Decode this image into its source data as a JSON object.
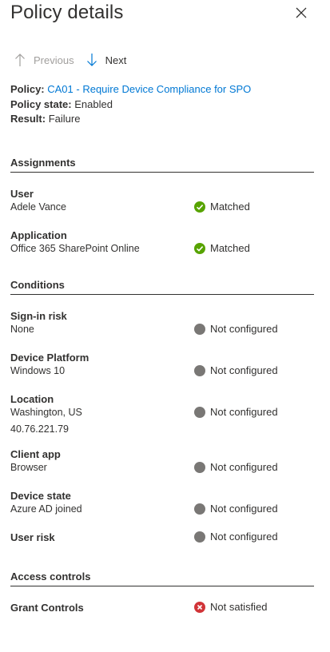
{
  "panel": {
    "title": "Policy details",
    "close_icon": "close-icon"
  },
  "nav": {
    "previous_label": "Previous",
    "next_label": "Next"
  },
  "summary": {
    "policy_label": "Policy:",
    "policy_value": "CA01 - Require Device Compliance for SPO",
    "state_label": "Policy state:",
    "state_value": "Enabled",
    "result_label": "Result:",
    "result_value": "Failure"
  },
  "sections": {
    "assignments": "Assignments",
    "conditions": "Conditions",
    "access_controls": "Access controls"
  },
  "assignments": {
    "user": {
      "label": "User",
      "value": "Adele Vance",
      "status": "Matched"
    },
    "application": {
      "label": "Application",
      "value": "Office 365 SharePoint Online",
      "status": "Matched"
    }
  },
  "conditions": {
    "signin_risk": {
      "label": "Sign-in risk",
      "value": "None",
      "status": "Not configured"
    },
    "device_platform": {
      "label": "Device Platform",
      "value": "Windows 10",
      "status": "Not configured"
    },
    "location": {
      "label": "Location",
      "value": "Washington, US",
      "value2": "40.76.221.79",
      "status": "Not configured"
    },
    "client_app": {
      "label": "Client app",
      "value": "Browser",
      "status": "Not configured"
    },
    "device_state": {
      "label": "Device state",
      "value": "Azure AD joined",
      "status": "Not configured"
    },
    "user_risk": {
      "label": "User risk",
      "status": "Not configured"
    }
  },
  "access_controls": {
    "grant_controls": {
      "label": "Grant Controls",
      "status": "Not satisfied"
    }
  },
  "colors": {
    "link": "#0078d4",
    "matched": "#57a300",
    "not_configured": "#797775",
    "not_satisfied": "#d13438",
    "disabled_text": "#a19f9d"
  }
}
